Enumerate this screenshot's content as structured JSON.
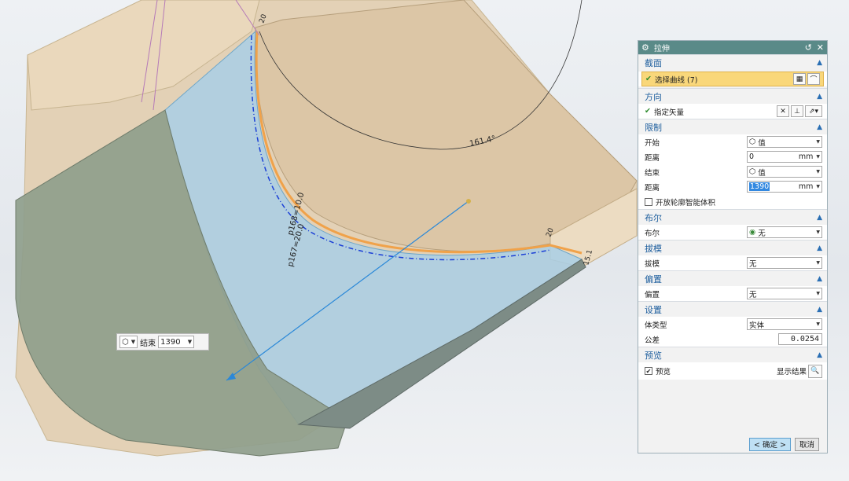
{
  "viewport": {
    "angle_dim": "161.4°",
    "dim_p168": "p168=10.0",
    "dim_p167": "p167=20.0",
    "dim_small1": "20",
    "dim_small2": "20",
    "dim_small3": "15.1",
    "float_input": {
      "label": "结束",
      "value": "1390"
    }
  },
  "dialog": {
    "title": "拉伸",
    "sections": {
      "section": {
        "header": "截面",
        "select_curve": "选择曲线 (7)"
      },
      "direction": {
        "header": "方向",
        "specify_vector": "指定矢量"
      },
      "limits": {
        "header": "限制",
        "start_label": "开始",
        "start_value": "值",
        "distance1_label": "距离",
        "distance1_value": "0",
        "distance1_unit": "mm",
        "end_label": "结束",
        "end_value": "值",
        "distance2_label": "距离",
        "distance2_value": "1390",
        "distance2_unit": "mm",
        "open_profile": "开放轮廓智能体积"
      },
      "boolean": {
        "header": "布尔",
        "label": "布尔",
        "value": "无"
      },
      "draft": {
        "header": "拔模",
        "label": "拔模",
        "value": "无"
      },
      "offset": {
        "header": "偏置",
        "label": "偏置",
        "value": "无"
      },
      "settings": {
        "header": "设置",
        "body_type_label": "体类型",
        "body_type_value": "实体",
        "tolerance_label": "公差",
        "tolerance_value": "0.0254"
      },
      "preview": {
        "header": "预览",
        "checkbox_label": "预览",
        "show_result": "显示结果"
      }
    },
    "buttons": {
      "ok": "< 确定 >",
      "cancel": "取消"
    }
  }
}
